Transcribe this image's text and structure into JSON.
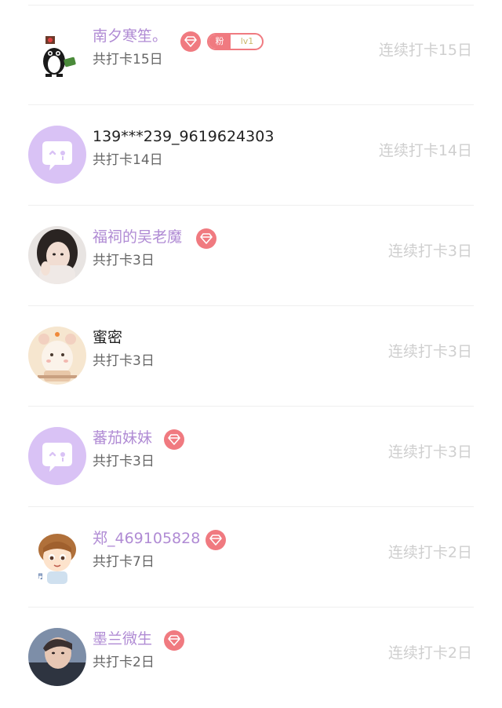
{
  "colors": {
    "vip_name": "#b08bd4",
    "plain_name": "#222222",
    "total_text": "#666666",
    "streak_text": "#cfcfcf",
    "gem_badge": "#f07a80",
    "default_avatar_bg": "#d9c2f5"
  },
  "fan_badge": {
    "label": "粉",
    "level": "lv1"
  },
  "users": [
    {
      "name": "南夕寒笙。",
      "total": "共打卡15日",
      "streak": "连续打卡15日",
      "vip": true,
      "avatar": "panda-avatar"
    },
    {
      "name": "139***239_9619624303",
      "total": "共打卡14日",
      "streak": "连续打卡14日",
      "vip": false,
      "avatar": "default-chat-avatar"
    },
    {
      "name": "福祠的吴老魔",
      "total": "共打卡3日",
      "streak": "连续打卡3日",
      "vip": true,
      "avatar": "photo-avatar-girl"
    },
    {
      "name": "蜜密",
      "total": "共打卡3日",
      "streak": "连续打卡3日",
      "vip": false,
      "avatar": "hamster-avatar"
    },
    {
      "name": "蕃茄妹妹",
      "total": "共打卡3日",
      "streak": "连续打卡3日",
      "vip": true,
      "avatar": "default-chat-avatar"
    },
    {
      "name": "郑_469105828",
      "total": "共打卡7日",
      "streak": "连续打卡2日",
      "vip": true,
      "avatar": "cartoon-boy-avatar"
    },
    {
      "name": "墨兰微生",
      "total": "共打卡2日",
      "streak": "连续打卡2日",
      "vip": true,
      "avatar": "photo-avatar-man"
    }
  ]
}
